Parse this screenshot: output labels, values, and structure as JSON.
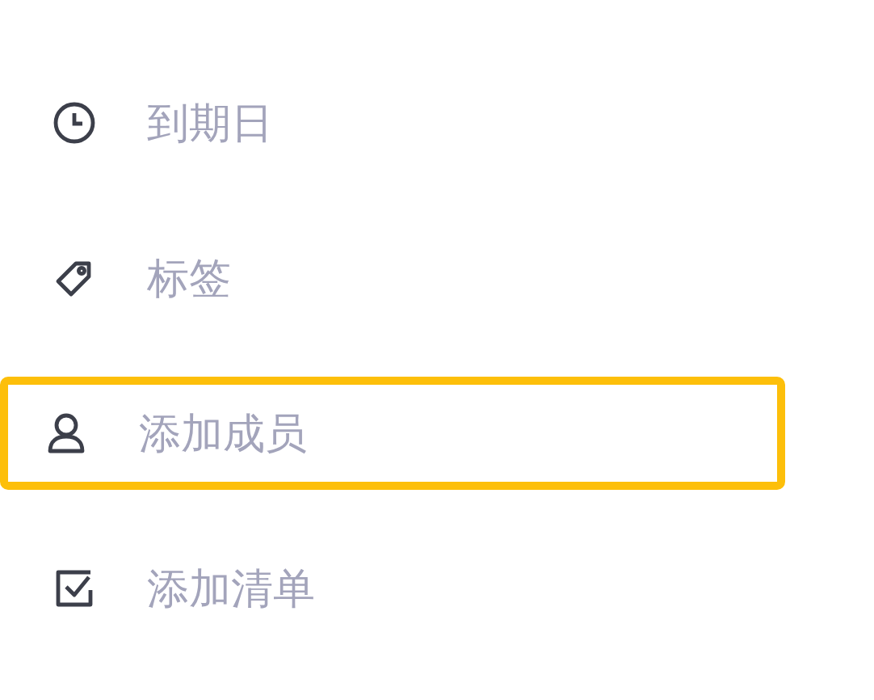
{
  "menu_items": [
    {
      "kind": "clock",
      "label": "到期日",
      "highlighted": false
    },
    {
      "kind": "tag",
      "label": "标签",
      "highlighted": false
    },
    {
      "kind": "person",
      "label": "添加成员",
      "highlighted": true
    },
    {
      "kind": "checkbox",
      "label": "添加清单",
      "highlighted": false
    }
  ]
}
